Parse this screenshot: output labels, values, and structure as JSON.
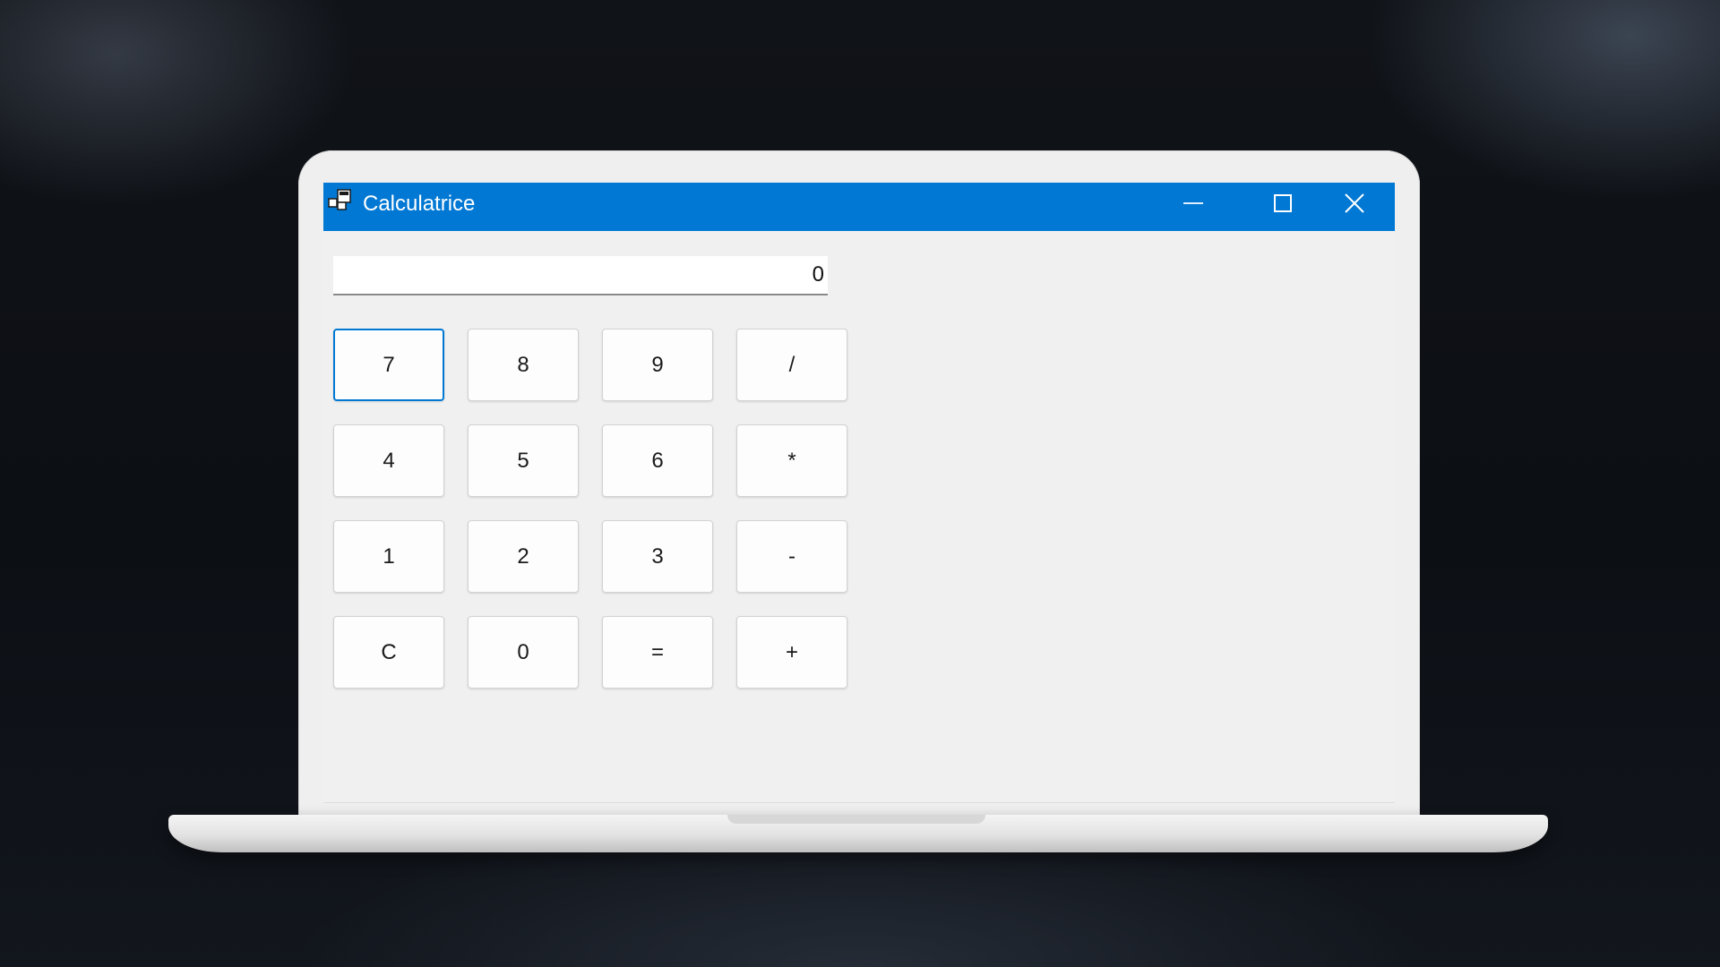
{
  "window": {
    "title": "Calculatrice",
    "accent_color": "#0078d4",
    "controls": {
      "minimize_icon": "minimize-icon",
      "maximize_icon": "maximize-icon",
      "close_icon": "close-icon"
    }
  },
  "display": {
    "value": "0"
  },
  "keypad": {
    "keys": [
      {
        "label": "7",
        "name": "key-7",
        "focused": true
      },
      {
        "label": "8",
        "name": "key-8"
      },
      {
        "label": "9",
        "name": "key-9"
      },
      {
        "label": "/",
        "name": "key-divide"
      },
      {
        "label": "4",
        "name": "key-4"
      },
      {
        "label": "5",
        "name": "key-5"
      },
      {
        "label": "6",
        "name": "key-6"
      },
      {
        "label": "*",
        "name": "key-multiply"
      },
      {
        "label": "1",
        "name": "key-1"
      },
      {
        "label": "2",
        "name": "key-2"
      },
      {
        "label": "3",
        "name": "key-3"
      },
      {
        "label": "-",
        "name": "key-subtract"
      },
      {
        "label": "C",
        "name": "key-clear"
      },
      {
        "label": "0",
        "name": "key-0"
      },
      {
        "label": "=",
        "name": "key-equals"
      },
      {
        "label": "+",
        "name": "key-add"
      }
    ]
  }
}
